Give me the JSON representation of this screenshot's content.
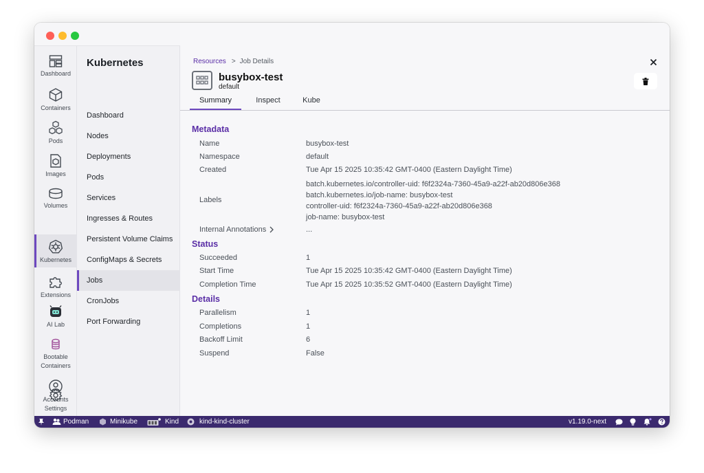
{
  "rail": {
    "items": [
      {
        "label": "Dashboard",
        "icon": "dashboard-icon"
      },
      {
        "label": "Containers",
        "icon": "container-icon"
      },
      {
        "label": "Pods",
        "icon": "pods-icon"
      },
      {
        "label": "Images",
        "icon": "image-icon"
      },
      {
        "label": "Volumes",
        "icon": "volume-icon"
      },
      {
        "label": "Kubernetes",
        "icon": "kubernetes-icon",
        "active": true
      },
      {
        "label": "Extensions",
        "icon": "puzzle-icon"
      },
      {
        "label": "AI Lab",
        "icon": "ai-lab-icon"
      },
      {
        "label": "Bootable Containers",
        "icon": "bootable-icon"
      },
      {
        "label": "Accounts",
        "icon": "user-icon"
      },
      {
        "label": "Settings",
        "icon": "gear-icon"
      }
    ]
  },
  "subnav": {
    "title": "Kubernetes",
    "items": [
      {
        "label": "Dashboard"
      },
      {
        "label": "Nodes"
      },
      {
        "label": "Deployments"
      },
      {
        "label": "Pods"
      },
      {
        "label": "Services"
      },
      {
        "label": "Ingresses & Routes"
      },
      {
        "label": "Persistent Volume Claims"
      },
      {
        "label": "ConfigMaps & Secrets"
      },
      {
        "label": "Jobs",
        "active": true
      },
      {
        "label": "CronJobs"
      },
      {
        "label": "Port Forwarding"
      }
    ]
  },
  "breadcrumb": {
    "root": "Resources",
    "separator": ">",
    "current": "Job Details"
  },
  "header": {
    "title": "busybox-test",
    "namespace": "default"
  },
  "tabs": [
    {
      "label": "Summary",
      "active": true
    },
    {
      "label": "Inspect"
    },
    {
      "label": "Kube"
    }
  ],
  "metadata": {
    "title": "Metadata",
    "name_key": "Name",
    "name_val": "busybox-test",
    "namespace_key": "Namespace",
    "namespace_val": "default",
    "created_key": "Created",
    "created_val": "Tue Apr 15 2025 10:35:42 GMT-0400 (Eastern Daylight Time)",
    "labels_key": "Labels",
    "labels": [
      "batch.kubernetes.io/controller-uid: f6f2324a-7360-45a9-a22f-ab20d806e368",
      "batch.kubernetes.io/job-name: busybox-test",
      "controller-uid: f6f2324a-7360-45a9-a22f-ab20d806e368",
      "job-name: busybox-test"
    ],
    "annotations_key": "Internal Annotations",
    "annotations_val": "..."
  },
  "status": {
    "title": "Status",
    "succeeded_key": "Succeeded",
    "succeeded_val": "1",
    "start_key": "Start Time",
    "start_val": "Tue Apr 15 2025 10:35:42 GMT-0400 (Eastern Daylight Time)",
    "completion_key": "Completion Time",
    "completion_val": "Tue Apr 15 2025 10:35:52 GMT-0400 (Eastern Daylight Time)"
  },
  "details": {
    "title": "Details",
    "parallelism_key": "Parallelism",
    "parallelism_val": "1",
    "completions_key": "Completions",
    "completions_val": "1",
    "backoff_key": "Backoff Limit",
    "backoff_val": "6",
    "suspend_key": "Suspend",
    "suspend_val": "False"
  },
  "statusbar": {
    "podman": "Podman",
    "minikube": "Minikube",
    "kind": "Kind",
    "cluster": "kind-kind-cluster",
    "version": "v1.19.0-next"
  },
  "colors": {
    "accent": "#6d48bf",
    "accent_text": "#5a2ea6",
    "statusbar": "#3b2a6e"
  }
}
